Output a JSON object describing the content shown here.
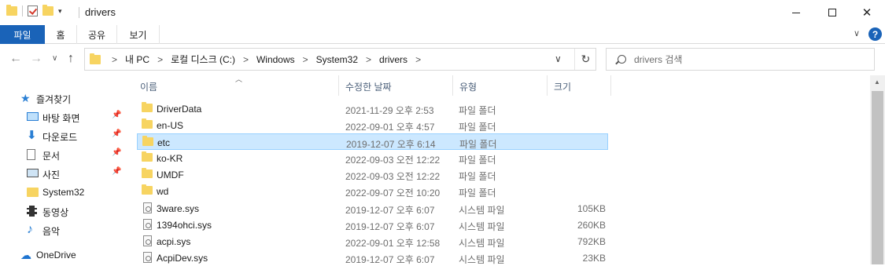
{
  "window": {
    "title": "drivers",
    "controls": {
      "minimize": "minimize",
      "maximize": "maximize",
      "close": "✕"
    }
  },
  "ribbon": {
    "tabs": [
      {
        "label": "파일"
      },
      {
        "label": "홈"
      },
      {
        "label": "공유"
      },
      {
        "label": "보기"
      }
    ],
    "help": "?"
  },
  "address": {
    "crumbs": [
      "내 PC",
      "로컬 디스크 (C:)",
      "Windows",
      "System32",
      "drivers"
    ],
    "separator": ">"
  },
  "search": {
    "placeholder": "drivers 검색"
  },
  "nav": {
    "quick_access": "즐겨찾기",
    "items": [
      {
        "label": "바탕 화면",
        "icon": "desktop-icon",
        "pinned": true
      },
      {
        "label": "다운로드",
        "icon": "download-icon",
        "pinned": true
      },
      {
        "label": "문서",
        "icon": "documents-icon",
        "pinned": true
      },
      {
        "label": "사진",
        "icon": "pictures-icon",
        "pinned": true
      },
      {
        "label": "System32",
        "icon": "folder-icon",
        "pinned": false
      },
      {
        "label": "동영상",
        "icon": "videos-icon",
        "pinned": false
      },
      {
        "label": "음악",
        "icon": "music-icon",
        "pinned": false
      }
    ],
    "onedrive": "OneDrive"
  },
  "columns": {
    "name": "이름",
    "date": "수정한 날짜",
    "type": "유형",
    "size": "크기"
  },
  "files": [
    {
      "name": "DriverData",
      "date": "2021-11-29 오후 2:53",
      "type": "파일 폴더",
      "size": "",
      "kind": "folder"
    },
    {
      "name": "en-US",
      "date": "2022-09-01 오후 4:57",
      "type": "파일 폴더",
      "size": "",
      "kind": "folder"
    },
    {
      "name": "etc",
      "date": "2019-12-07 오후 6:14",
      "type": "파일 폴더",
      "size": "",
      "kind": "folder",
      "selected": true
    },
    {
      "name": "ko-KR",
      "date": "2022-09-03 오전 12:22",
      "type": "파일 폴더",
      "size": "",
      "kind": "folder"
    },
    {
      "name": "UMDF",
      "date": "2022-09-03 오전 12:22",
      "type": "파일 폴더",
      "size": "",
      "kind": "folder"
    },
    {
      "name": "wd",
      "date": "2022-09-07 오전 10:20",
      "type": "파일 폴더",
      "size": "",
      "kind": "folder"
    },
    {
      "name": "3ware.sys",
      "date": "2019-12-07 오후 6:07",
      "type": "시스템 파일",
      "size": "105KB",
      "kind": "sys"
    },
    {
      "name": "1394ohci.sys",
      "date": "2019-12-07 오후 6:07",
      "type": "시스템 파일",
      "size": "260KB",
      "kind": "sys"
    },
    {
      "name": "acpi.sys",
      "date": "2022-09-01 오후 12:58",
      "type": "시스템 파일",
      "size": "792KB",
      "kind": "sys"
    },
    {
      "name": "AcpiDev.sys",
      "date": "2019-12-07 오후 6:07",
      "type": "시스템 파일",
      "size": "23KB",
      "kind": "sys"
    }
  ],
  "colors": {
    "accent": "#1a63b8",
    "selection": "#cce8ff",
    "folder": "#f7d461"
  }
}
